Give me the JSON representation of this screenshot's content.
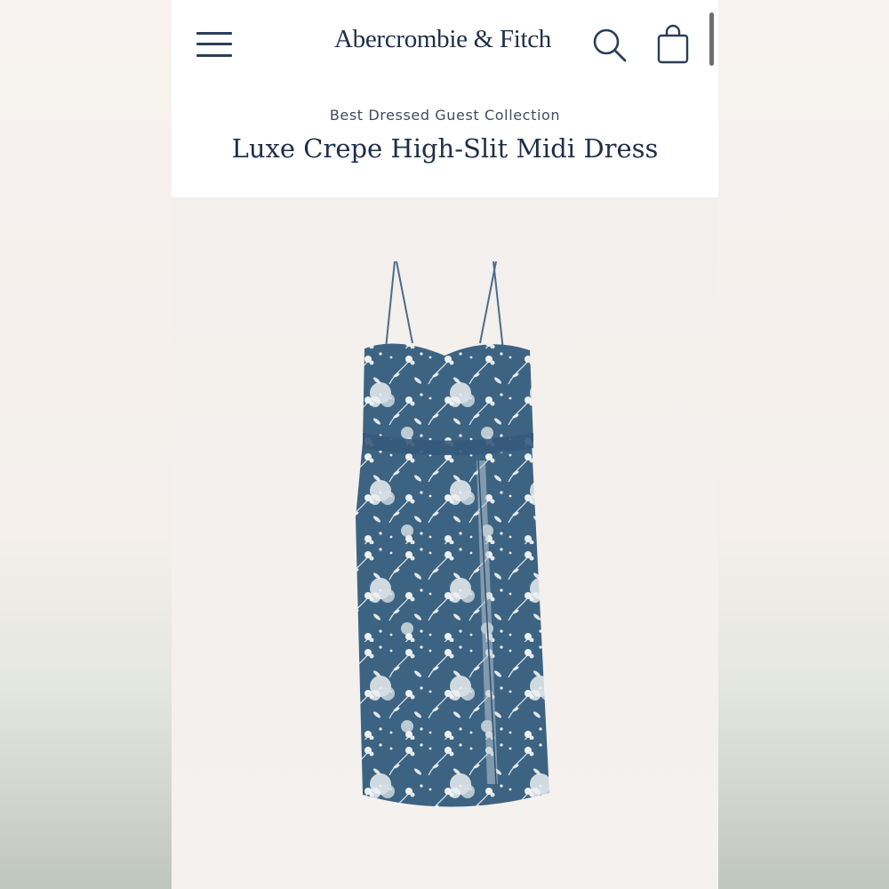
{
  "header": {
    "brand": "Abercrombie & Fitch",
    "menu_icon": "hamburger-menu-icon",
    "search_icon": "search-icon",
    "bag_icon": "shopping-bag-icon"
  },
  "product": {
    "collection": "Best Dressed Guest Collection",
    "title": "Luxe Crepe High-Slit Midi Dress",
    "image": "floral-midi-dress-image"
  },
  "colors": {
    "brand_navy": "#1f2f47",
    "dress_blue": "#3d6382",
    "print_white": "#eef1f2"
  }
}
